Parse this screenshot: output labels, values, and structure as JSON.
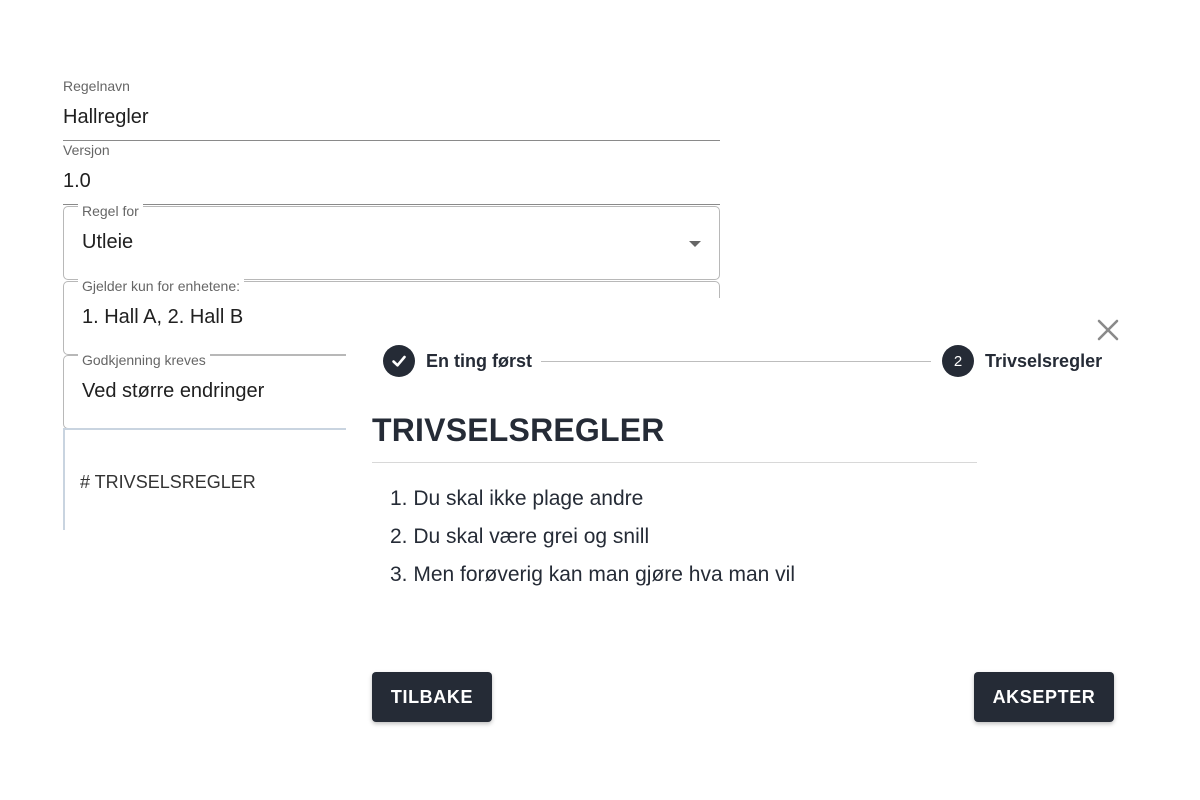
{
  "form": {
    "rule_name": {
      "label": "Regelnavn",
      "value": "Hallregler"
    },
    "version": {
      "label": "Versjon",
      "value": "1.0"
    },
    "rule_for": {
      "label": "Regel for",
      "value": "Utleie"
    },
    "applies_to": {
      "label": "Gjelder kun for enhetene:",
      "value": "1. Hall A, 2. Hall B"
    },
    "approval": {
      "label": "Godkjenning kreves",
      "value": "Ved større endringer"
    },
    "editor_text": "# TRIVSELSREGLER"
  },
  "dialog": {
    "steps": [
      {
        "label": "En ting først",
        "number": "",
        "status": "completed"
      },
      {
        "label": "Trivselsregler",
        "number": "2",
        "status": "active"
      }
    ],
    "title": "TRIVSELSREGLER",
    "rules": [
      "1. Du skal ikke plage andre",
      "2. Du skal være grei og snill",
      "3. Men forøverig kan man gjøre hva man vil"
    ],
    "back_label": "TILBAKE",
    "accept_label": "AKSEPTER"
  },
  "colors": {
    "primary": "#252b36",
    "divider": "#bdbdbd"
  },
  "icons": {
    "step1": "check-icon",
    "close": "close-icon",
    "dropdown": "caret-down-icon"
  }
}
